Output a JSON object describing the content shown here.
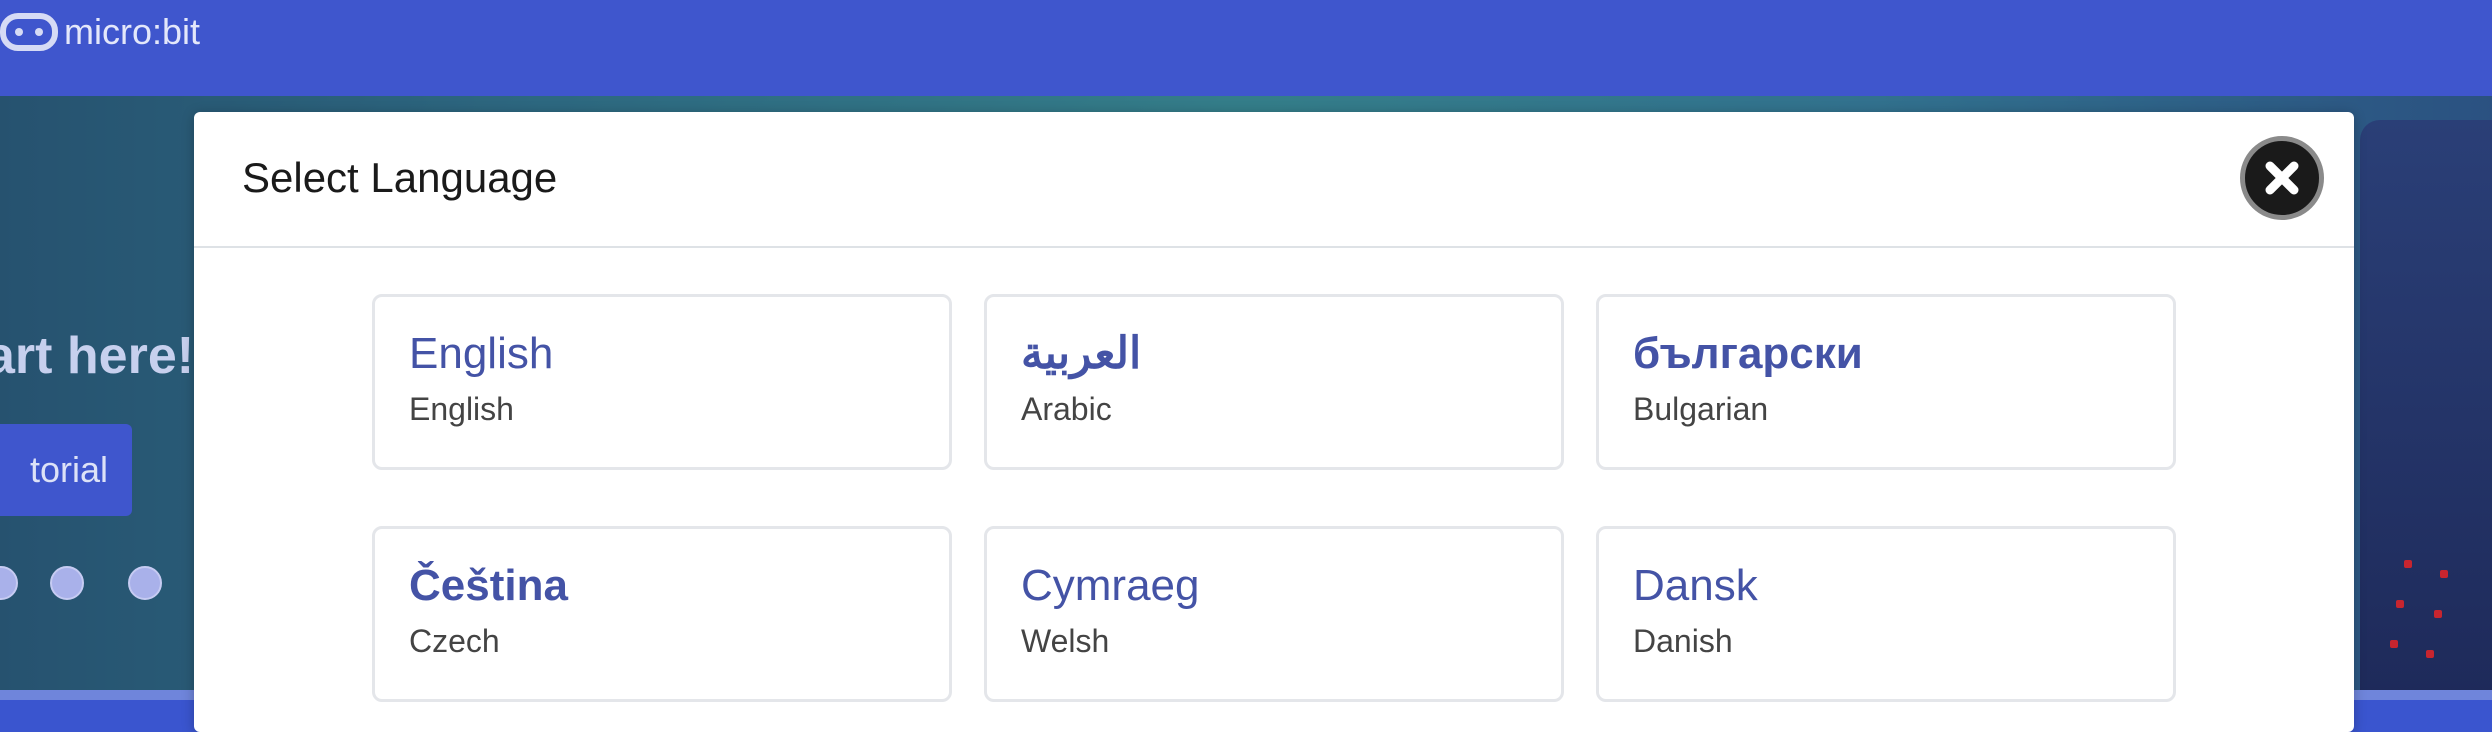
{
  "header": {
    "logo_text": "micro:bit"
  },
  "hero": {
    "heading": "art here!",
    "button_label": "torial",
    "dots_count": 3
  },
  "modal": {
    "title": "Select Language",
    "close_icon": "close-icon",
    "languages": [
      {
        "native": "English",
        "english": "English"
      },
      {
        "native": "العربية",
        "english": "Arabic"
      },
      {
        "native": "български",
        "english": "Bulgarian"
      },
      {
        "native": "Čeština",
        "english": "Czech"
      },
      {
        "native": "Cymraeg",
        "english": "Welsh"
      },
      {
        "native": "Dansk",
        "english": "Danish"
      }
    ]
  },
  "colors": {
    "header_bg": "#3f56cd",
    "language_name": "#4453a6",
    "modal_bg": "#ffffff"
  }
}
